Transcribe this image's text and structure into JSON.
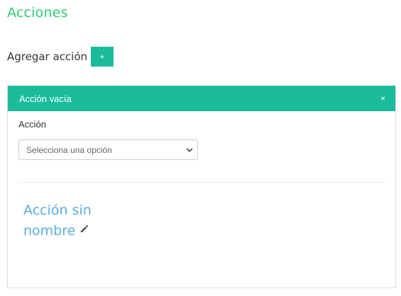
{
  "section": {
    "title": "Acciones"
  },
  "add_action": {
    "label": "Agregar acción",
    "button_label": "+"
  },
  "panel": {
    "title": "Acción vacía",
    "close_label": "×",
    "field_label": "Acción",
    "select": {
      "selected": "Selecciona una opción"
    },
    "action_name": "Acción sin nombre"
  },
  "colors": {
    "title_green": "#2ecc71",
    "accent_teal": "#1abc9c",
    "name_blue": "#5dade2"
  },
  "icons": {
    "edit": "pencil-icon",
    "dropdown": "chevron-down-icon",
    "close": "close-icon"
  }
}
